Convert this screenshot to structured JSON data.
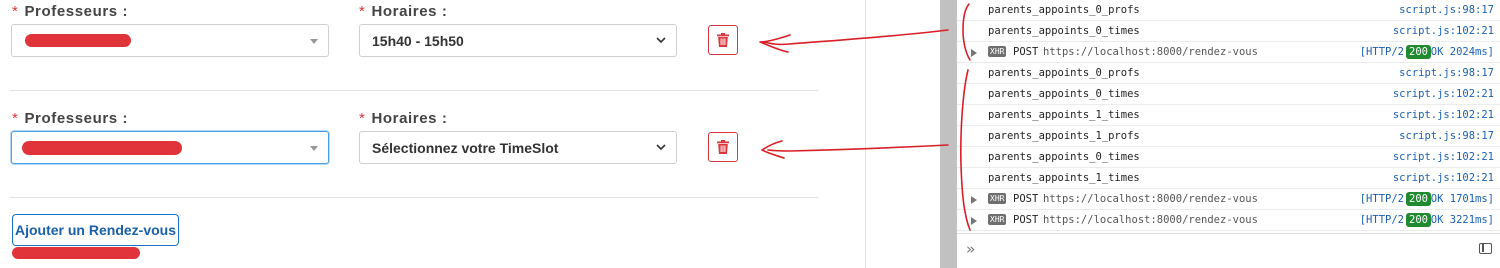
{
  "form": {
    "entries": [
      {
        "prof_label": "Professeurs :",
        "prof_value": "",
        "time_label": "Horaires :",
        "time_value": "15h40 - 15h50"
      },
      {
        "prof_label": "Professeurs :",
        "prof_value": "",
        "time_label": "Horaires :",
        "time_value": "Sélectionnez votre TimeSlot"
      }
    ],
    "required_mark": "*",
    "add_button": "Ajouter un Rendez-vous"
  },
  "console": {
    "rows": [
      {
        "type": "log",
        "msg": "parents_appoints_0_profs",
        "src": "script.js:98:17"
      },
      {
        "type": "log",
        "msg": "parents_appoints_0_times",
        "src": "script.js:102:21"
      },
      {
        "type": "xhr",
        "badge": "XHR",
        "method": "POST",
        "url": "https://localhost:8000/rendez-vous",
        "protocol": "[HTTP/2",
        "status": "200",
        "timing": "OK 2024ms]"
      },
      {
        "type": "log",
        "msg": "parents_appoints_0_profs",
        "src": "script.js:98:17"
      },
      {
        "type": "log",
        "msg": "parents_appoints_0_times",
        "src": "script.js:102:21"
      },
      {
        "type": "log",
        "msg": "parents_appoints_1_times",
        "src": "script.js:102:21"
      },
      {
        "type": "log",
        "msg": "parents_appoints_1_profs",
        "src": "script.js:98:17"
      },
      {
        "type": "log",
        "msg": "parents_appoints_0_times",
        "src": "script.js:102:21"
      },
      {
        "type": "log",
        "msg": "parents_appoints_1_times",
        "src": "script.js:102:21"
      },
      {
        "type": "xhr",
        "badge": "XHR",
        "method": "POST",
        "url": "https://localhost:8000/rendez-vous",
        "protocol": "[HTTP/2",
        "status": "200",
        "timing": "OK 1701ms]"
      },
      {
        "type": "xhr",
        "badge": "XHR",
        "method": "POST",
        "url": "https://localhost:8000/rendez-vous",
        "protocol": "[HTTP/2",
        "status": "200",
        "timing": "OK 3221ms]"
      }
    ],
    "prompt_icon": "»",
    "colors": {
      "link": "#1a5fb4",
      "status_ok": "#1f8a2f",
      "xhr_badge": "#6e6e6e"
    }
  },
  "icons": [
    "trash-icon",
    "dropdown-arrow-icon",
    "chevron-down-icon",
    "expand-triangle-icon",
    "console-prompt-icon",
    "sidebar-toggle-icon"
  ],
  "colors": {
    "required": "#d9363e",
    "primary": "#1a73c9",
    "redaction": "#e0343a",
    "annotation": "#d91f26"
  }
}
